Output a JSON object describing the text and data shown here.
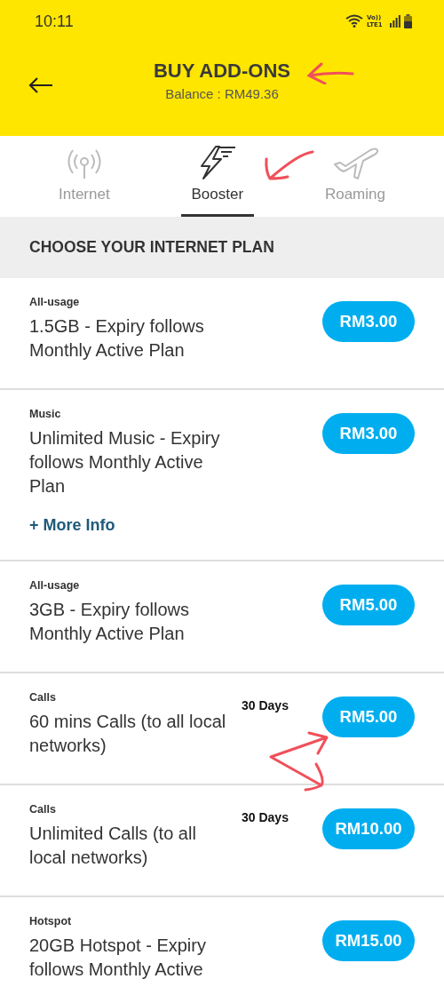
{
  "status_bar": {
    "time": "10:11",
    "network_label": "Vo)) LTE1"
  },
  "header": {
    "title": "BUY ADD-ONS",
    "balance": "Balance : RM49.36"
  },
  "tabs": [
    {
      "label": "Internet",
      "kind": "antenna",
      "selected": false
    },
    {
      "label": "Booster",
      "kind": "bolt",
      "selected": true
    },
    {
      "label": "Roaming",
      "kind": "plane",
      "selected": false
    }
  ],
  "section_title": "CHOOSE YOUR INTERNET PLAN",
  "plans": [
    {
      "category": "All-usage",
      "description": "1.5GB - Expiry follows Monthly Active Plan",
      "price": "RM3.00"
    },
    {
      "category": "Music",
      "description": "Unlimited Music - Expiry follows Monthly Active Plan",
      "price": "RM3.00",
      "more_info": "+ More Info"
    },
    {
      "category": "All-usage",
      "description": "3GB - Expiry follows Monthly Active Plan",
      "price": "RM5.00"
    },
    {
      "category": "Calls",
      "description": "60 mins Calls (to all local networks)",
      "price": "RM5.00",
      "validity": "30 Days"
    },
    {
      "category": "Calls",
      "description": "Unlimited Calls (to all local networks)",
      "price": "RM10.00",
      "validity": "30 Days"
    },
    {
      "category": "Hotspot",
      "description": "20GB Hotspot - Expiry follows Monthly Active",
      "price": "RM15.00"
    }
  ]
}
